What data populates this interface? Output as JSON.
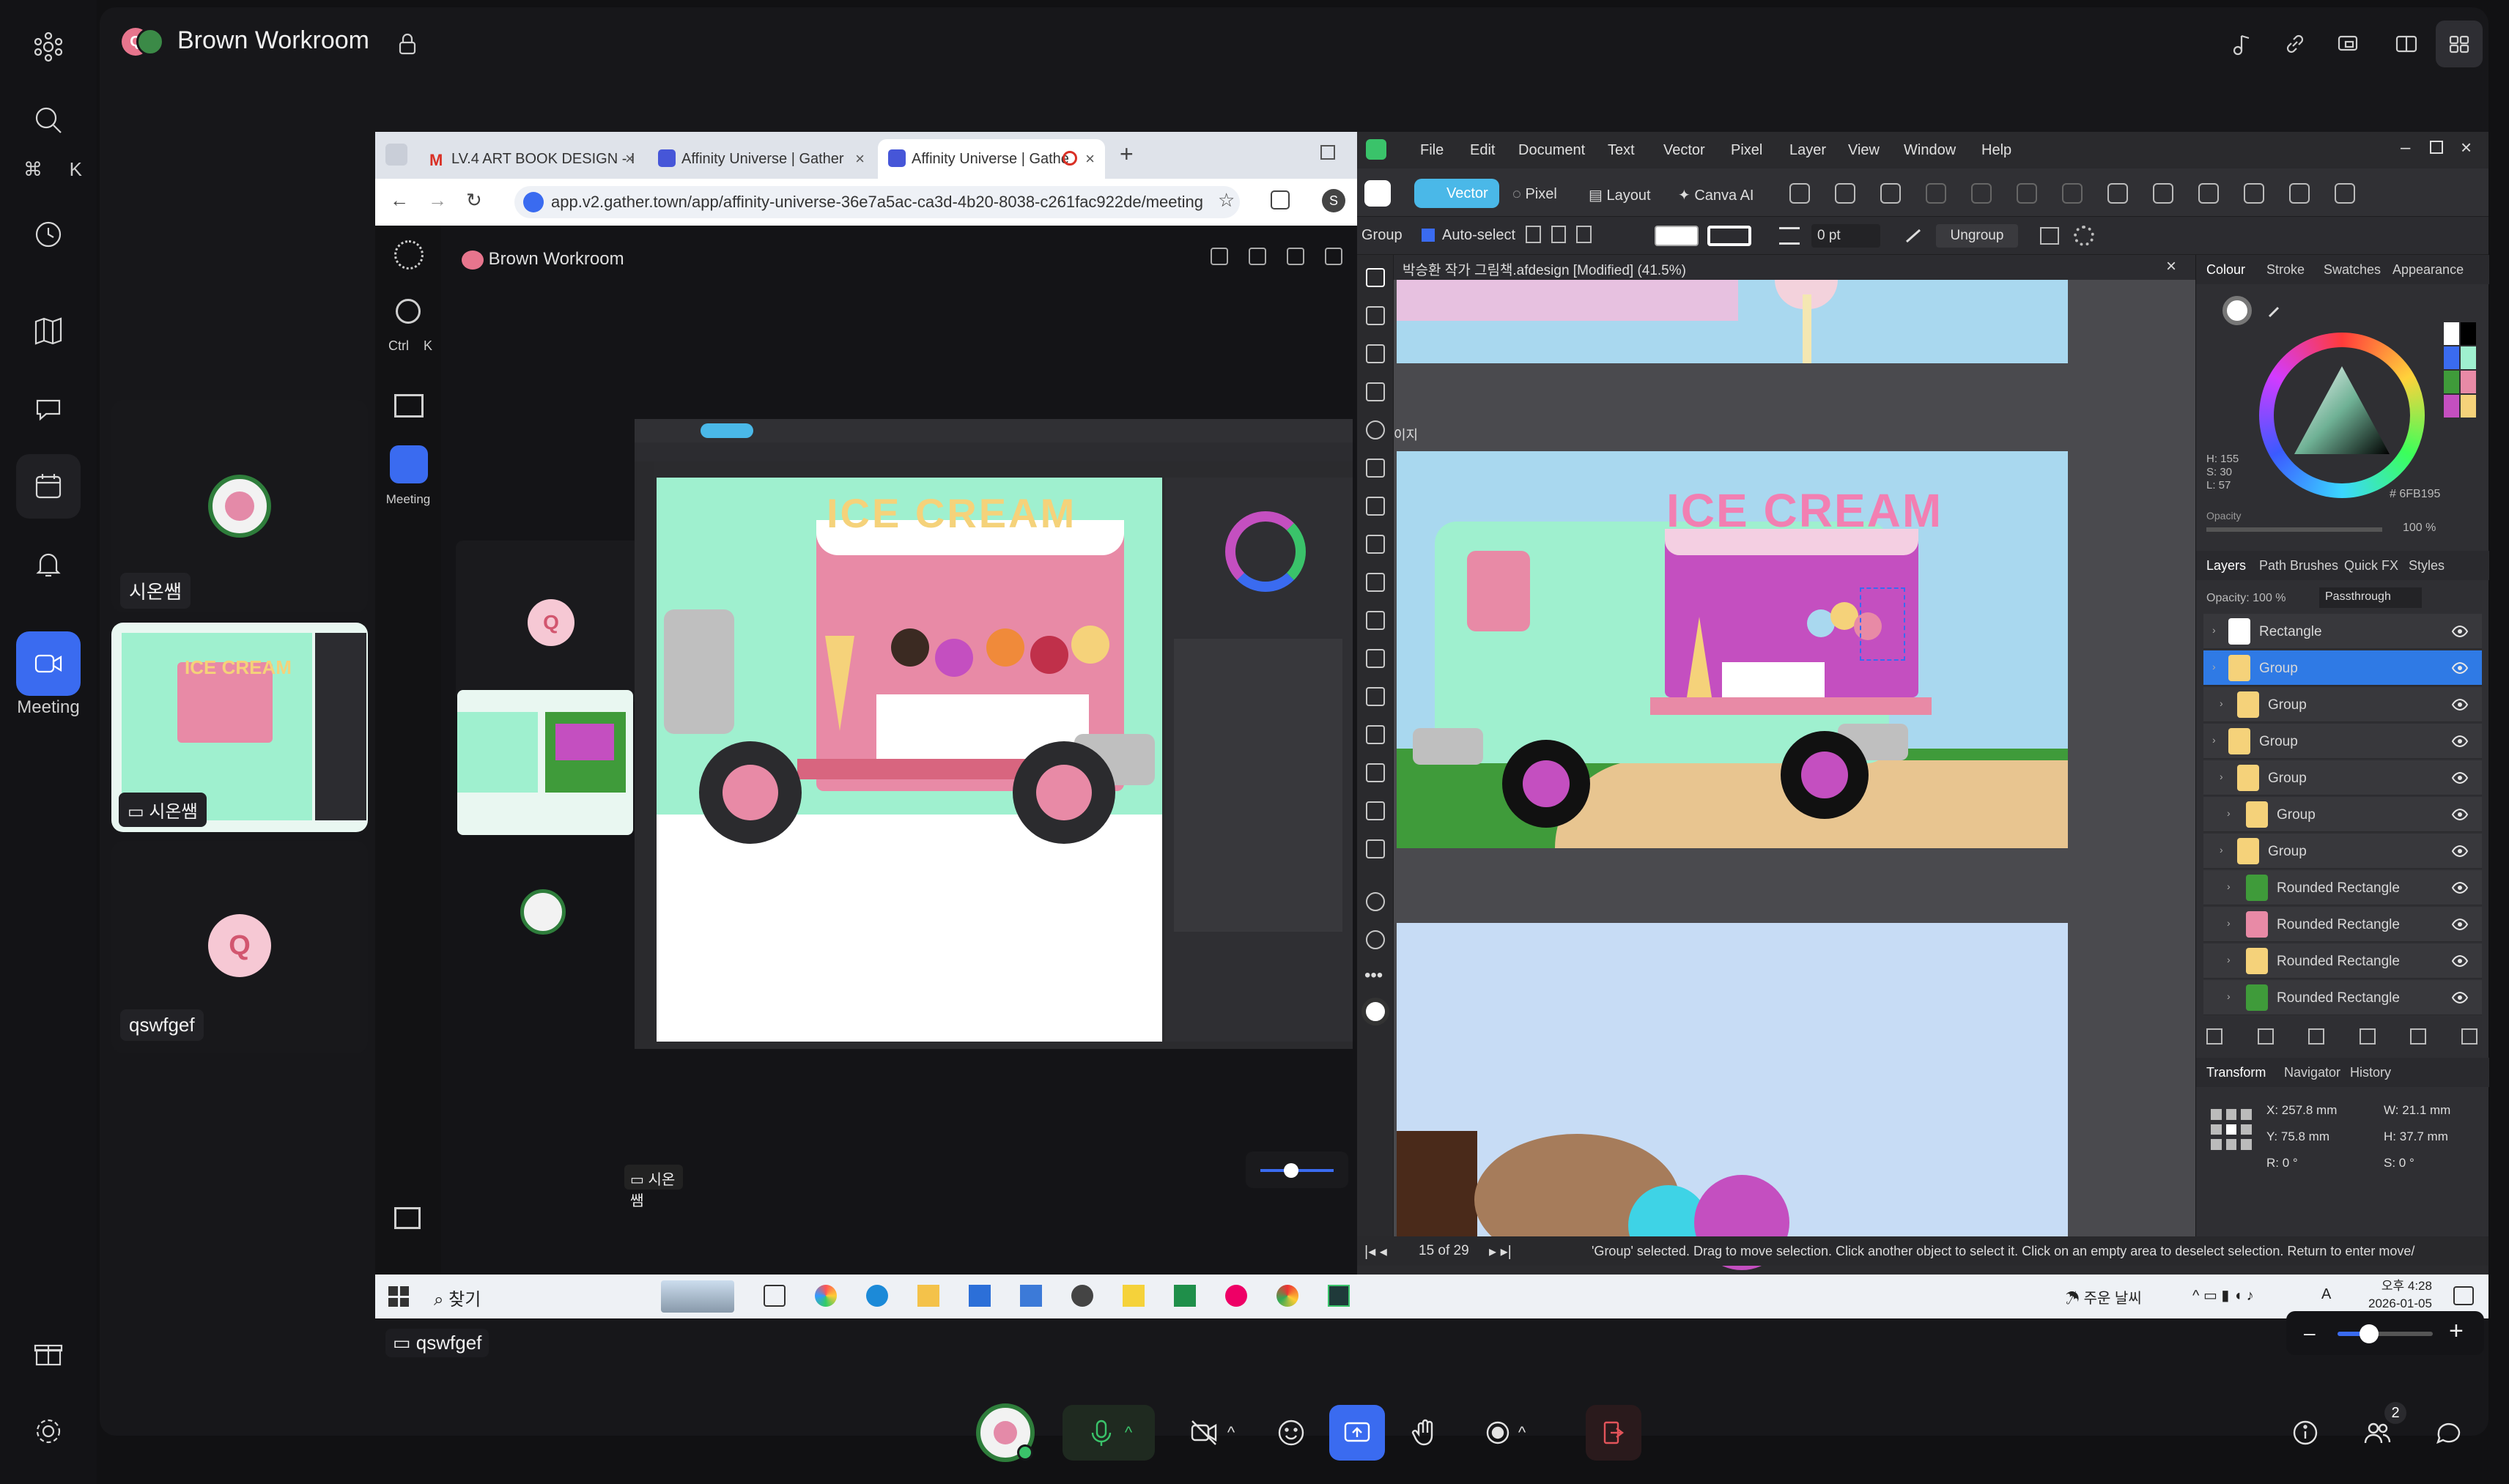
{
  "gather": {
    "room_title": "Brown Workroom",
    "search_shortcut": [
      "⌘",
      "K"
    ],
    "meeting_label": "Meeting",
    "participants": [
      {
        "name": "시온쌤",
        "initial": ""
      },
      {
        "name": "qswfgef",
        "initial": "Q"
      }
    ],
    "screen_share_owner": "시온쌤",
    "screen_share_label_bottom": "qswfgef",
    "people_count": "2"
  },
  "chrome": {
    "tabs": [
      {
        "label": "LV.4 ART BOOK DESIGN - I"
      },
      {
        "label": "Affinity Universe | Gather"
      },
      {
        "label": "Affinity Universe | Gathe"
      }
    ],
    "url": "app.v2.gather.town/app/affinity-universe-36e7a5ac-ca3d-4b20-8038-c261fac922de/meeting"
  },
  "inner_gather": {
    "room_title": "Brown Workroom",
    "shortcut": [
      "Ctrl",
      "K"
    ],
    "meeting_label": "Meeting",
    "share_label": "시온쌤",
    "inner_avatar_initial": "Q",
    "mini_canvas_title": "ICE CREAM"
  },
  "affinity": {
    "menu": [
      "File",
      "Edit",
      "Document",
      "Text",
      "Vector",
      "Pixel",
      "Layer",
      "View",
      "Window",
      "Help"
    ],
    "personas": [
      "Vector",
      "Pixel",
      "Layout",
      "Canva AI"
    ],
    "context": {
      "group_label": "Group",
      "auto_select": "Auto-select",
      "stroke_width": "0 pt",
      "ungroup": "Ungroup"
    },
    "doc_title": "박승환 작가 그림책.afdesign [Modified] (41.5%)",
    "page_label": "이지",
    "canvas_title": "ICE CREAM",
    "colour_tabs": [
      "Colour",
      "Stroke",
      "Swatches",
      "Appearance"
    ],
    "hsl": [
      "H: 155",
      "S: 30",
      "L: 57"
    ],
    "hex": "6FB195",
    "opacity_label": "Opacity",
    "opacity_pct": "100 %",
    "layer_tabs": [
      "Layers",
      "Path Brushes",
      "Quick FX",
      "Styles"
    ],
    "layer_opacity": "100 %",
    "blend_mode": "Passthrough",
    "layers": [
      {
        "name": "Rectangle",
        "selected": false,
        "indent": 0
      },
      {
        "name": "Group",
        "selected": true,
        "indent": 0
      },
      {
        "name": "Group",
        "selected": false,
        "indent": 1
      },
      {
        "name": "Group",
        "selected": false,
        "indent": 0
      },
      {
        "name": "Group",
        "selected": false,
        "indent": 1
      },
      {
        "name": "Group",
        "selected": false,
        "indent": 2
      },
      {
        "name": "Group",
        "selected": false,
        "indent": 1
      },
      {
        "name": "Rounded Rectangle",
        "selected": false,
        "indent": 2
      },
      {
        "name": "Rounded Rectangle",
        "selected": false,
        "indent": 2
      },
      {
        "name": "Rounded Rectangle",
        "selected": false,
        "indent": 2
      },
      {
        "name": "Rounded Rectangle",
        "selected": false,
        "indent": 2
      }
    ],
    "transform_tabs": [
      "Transform",
      "Navigator",
      "History"
    ],
    "transform": {
      "x": "257.8 mm",
      "y": "75.8 mm",
      "w": "21.1 mm",
      "h": "37.7 mm",
      "r": "0 °",
      "s": "0 °"
    },
    "pager": "15 of 29",
    "status_text": "'Group' selected. Drag to move selection. Click another object to select it. Click on an empty area to deselect selection. Return to enter move/"
  },
  "taskbar": {
    "search_label": "찾기",
    "weather": "주운 날씨",
    "lang": "A",
    "time": "오후 4:28",
    "date": "2026-01-05"
  },
  "colors": {
    "accent": "#3a6bf0",
    "mint": "#9ff0cf",
    "truck_pink": "#e88aa6",
    "magenta": "#c44fc0",
    "sky": "#a9d8ef",
    "grass": "#3f9b3a",
    "sand": "#e8c590",
    "ice_yellow": "#f5d27a"
  }
}
